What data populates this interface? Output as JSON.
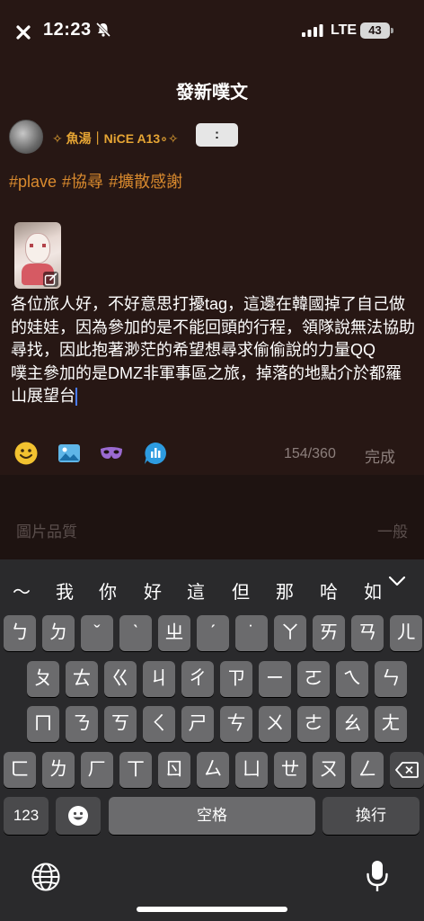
{
  "status_bar": {
    "time": "12:23",
    "network": "LTE",
    "battery": "43"
  },
  "header": {
    "title": "發新噗文"
  },
  "author": {
    "nickname": "✧ 魚湯｜NiCE A13∘✧",
    "more_label": ":"
  },
  "hashtags": [
    "#plave",
    "#協尋",
    "#擴散感謝"
  ],
  "post": {
    "paragraph1": "各位旅人好，不好意思打擾tag，這邊在韓國掉了自己做的娃娃，因為參加的是不能回頭的行程，領隊說無法協助尋找，因此抱著渺茫的希望想尋求偷偷說的力量QQ",
    "paragraph2": "噗主參加的是DMZ非軍事區之旅，掉落的地點介於都羅山展望台"
  },
  "toolbar": {
    "icons": [
      "emoji-icon",
      "image-icon",
      "mask-icon",
      "poll-icon"
    ],
    "char_count": "154/360",
    "done_label": "完成"
  },
  "settings": {
    "image_quality_label": "圖片品質",
    "image_quality_value": "一般"
  },
  "keyboard": {
    "suggestions": [
      "～",
      "我",
      "你",
      "好",
      "這",
      "但",
      "那",
      "哈",
      "如"
    ],
    "row1": [
      "ㄅ",
      "ㄉ",
      "ˇ",
      "ˋ",
      "ㄓ",
      "ˊ",
      "˙",
      "ㄚ",
      "ㄞ",
      "ㄢ",
      "ㄦ"
    ],
    "row2": [
      "ㄆ",
      "ㄊ",
      "ㄍ",
      "ㄐ",
      "ㄔ",
      "ㄗ",
      "ㄧ",
      "ㄛ",
      "ㄟ",
      "ㄣ"
    ],
    "row3": [
      "ㄇ",
      "ㄋ",
      "ㄎ",
      "ㄑ",
      "ㄕ",
      "ㄘ",
      "ㄨ",
      "ㄜ",
      "ㄠ",
      "ㄤ"
    ],
    "row4": [
      "ㄈ",
      "ㄌ",
      "ㄏ",
      "ㄒ",
      "ㄖ",
      "ㄙ",
      "ㄩ",
      "ㄝ",
      "ㄡ",
      "ㄥ"
    ],
    "numbers_label": "123",
    "space_label": "空格",
    "return_label": "換行"
  },
  "colors": {
    "background": "#271714",
    "accent": "#e6a534",
    "hashtag": "#d98a2e",
    "keyboard": "#2a2a2c"
  }
}
